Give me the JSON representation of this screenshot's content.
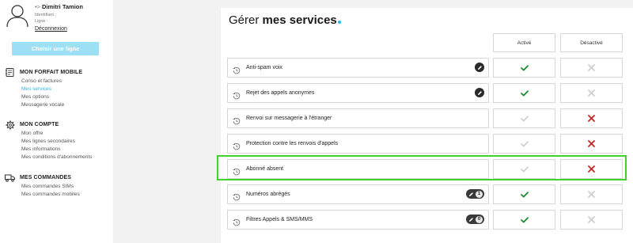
{
  "user": {
    "name": "Dimitri Tamion",
    "name_glyph": "•>",
    "identifier_label": "Identifiant :",
    "line_label": "Ligne :",
    "logout": "Déconnexion"
  },
  "choose_line_button": "Choisir une ligne",
  "nav": [
    {
      "title": "MON FORFAIT MOBILE",
      "icon": "phone-book-icon",
      "items": [
        {
          "label": "Conso et factures",
          "active": false
        },
        {
          "label": "Mes services",
          "active": true
        },
        {
          "label": "Mes options",
          "active": false
        },
        {
          "label": "Messagerie vocale",
          "active": false
        }
      ]
    },
    {
      "title": "MON COMPTE",
      "icon": "gear-icon",
      "items": [
        {
          "label": "Mon offre",
          "active": false
        },
        {
          "label": "Mes lignes secondaires",
          "active": false
        },
        {
          "label": "Mes informations",
          "active": false
        },
        {
          "label": "Mes conditions d'abonnements",
          "active": false
        }
      ]
    },
    {
      "title": "MES COMMANDES",
      "icon": "truck-icon",
      "items": [
        {
          "label": "Mes commandes SIMs",
          "active": false
        },
        {
          "label": "Mes commandes mobiles",
          "active": false
        }
      ]
    }
  ],
  "main": {
    "title_prefix": "Gérer ",
    "title_bold": "mes services",
    "col_active": "Activé",
    "col_inactive": "Désactivé",
    "colors": {
      "accent": "#2fb6e8",
      "check_on": "#1e8a2e",
      "cross_on": "#c62828",
      "muted": "#cfcfcf",
      "highlight": "#3fd42a"
    },
    "services": [
      {
        "name": "Anti-spam voix",
        "state": "active",
        "edit": "round"
      },
      {
        "name": "Rejet des appels anonymes",
        "state": "active",
        "edit": "round"
      },
      {
        "name": "Renvoi sur messagerie à l'étranger",
        "state": "inactive",
        "edit": "none"
      },
      {
        "name": "Protection contre les renvois d'appels",
        "state": "inactive",
        "edit": "none"
      },
      {
        "name": "Abonné absent",
        "state": "inactive",
        "edit": "none",
        "highlighted": true
      },
      {
        "name": "Numéros abrégés",
        "state": "active",
        "edit": "pill",
        "count": "1"
      },
      {
        "name": "Filtres Appels & SMS/MMS",
        "state": "active",
        "edit": "pill",
        "count": "0"
      }
    ]
  }
}
